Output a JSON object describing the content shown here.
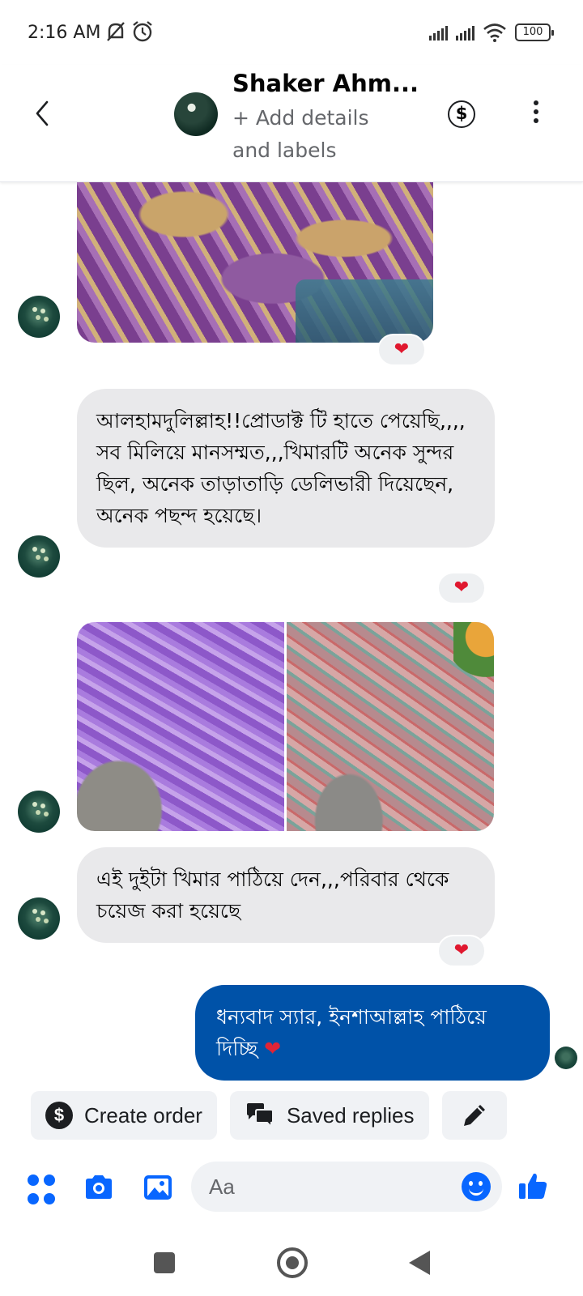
{
  "status_bar": {
    "time": "2:16 AM",
    "battery": "100"
  },
  "header": {
    "contact_name": "Shaker Ahm...",
    "subtitle": "+ Add details and labels",
    "payment_icon": "dollar-circle-icon",
    "more_icon": "more-vertical-icon"
  },
  "messages": [
    {
      "type": "image",
      "from": "contact",
      "description_icon": "photo",
      "reaction": "❤"
    },
    {
      "type": "text",
      "from": "contact",
      "text": "আলহামদুলিল্লাহ!!প্রোডাক্ট টি হাতে পেয়েছি,,,, সব মিলিয়ে মানসম্মত,,,খিমারটি অনেক সুন্দর ছিল, অনেক তাড়াতাড়ি ডেলিভারী দিয়েছেন, অনেক পছন্দ হয়েছে।",
      "reaction": "❤"
    },
    {
      "type": "image-pair",
      "from": "contact"
    },
    {
      "type": "text",
      "from": "contact",
      "text": "এই দুইটা খিমার পাঠিয়ে দেন,,,পরিবার থেকে চয়েজ করা হয়েছে",
      "reaction": "❤"
    },
    {
      "type": "text",
      "from": "me",
      "text": "ধন্যবাদ স্যার, ইনশাআল্লাহ পাঠিয়ে দিচ্ছি",
      "emoji": "❤"
    }
  ],
  "quick_actions": {
    "create_order": "Create order",
    "saved_replies": "Saved replies"
  },
  "composer": {
    "placeholder": "Aa"
  },
  "colors": {
    "accent": "#0866ff",
    "outgoing_bubble": "#0052a8",
    "incoming_bubble": "#e9e9eb",
    "heart": "#e0182f"
  }
}
